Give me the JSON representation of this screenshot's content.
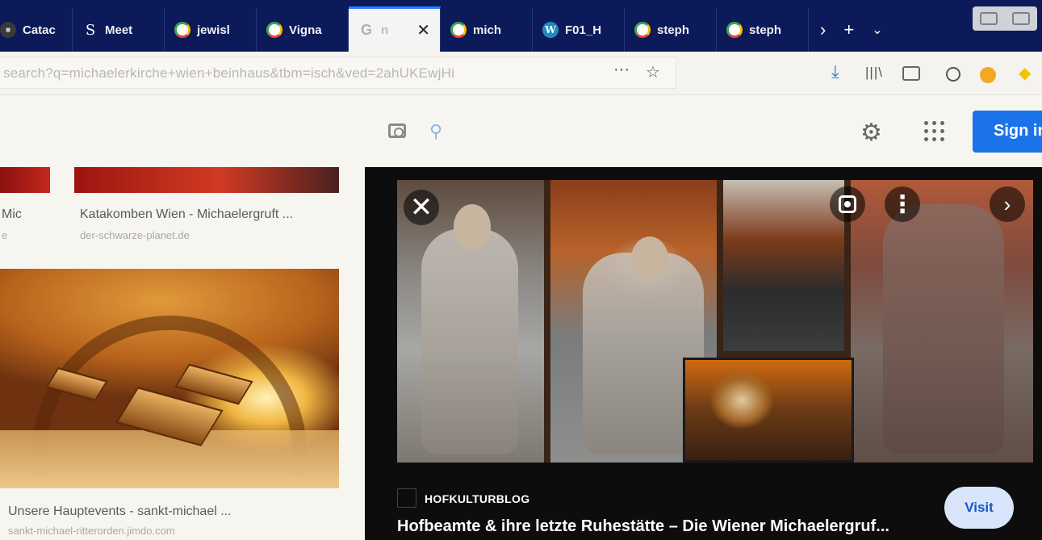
{
  "tabs": [
    {
      "label": "Catac",
      "icon": "dark-favicon"
    },
    {
      "label": "Meet",
      "icon": "s-favicon"
    },
    {
      "label": "jewisl",
      "icon": "google-favicon"
    },
    {
      "label": "Vigna",
      "icon": "google-favicon"
    },
    {
      "label": "n",
      "icon": "google-favicon",
      "active": true
    },
    {
      "label": "mich",
      "icon": "google-favicon"
    },
    {
      "label": "F01_H",
      "icon": "wordpress-favicon"
    },
    {
      "label": "steph",
      "icon": "google-favicon"
    },
    {
      "label": "steph",
      "icon": "google-favicon"
    }
  ],
  "active_tab_letter": "G",
  "url": "search?q=michaelerkirche+wien+beinhaus&tbm=isch&ved=2ahUKEwjHi",
  "toolbar": {
    "more_label": "···",
    "signin_label": "Sign in"
  },
  "results": [
    {
      "title": "Mic",
      "source": "e"
    },
    {
      "title": "Katakomben Wien - Michaelergruft ...",
      "source": "der-schwarze-planet.de"
    },
    {
      "title": "Unsere Hauptevents - sankt-michael ...",
      "source": "sankt-michael-ritterorden.jimdo.com"
    }
  ],
  "preview": {
    "site": "HOFKULTURBLOG",
    "title": "Hofbeamte & ihre letzte Ruhestätte – Die Wiener Michaelergruf...",
    "visit_label": "Visit"
  },
  "colors": {
    "tab_bar": "#0c1a5a",
    "accent_blue": "#1a73e8",
    "panel_bg": "#0d0d0d"
  }
}
